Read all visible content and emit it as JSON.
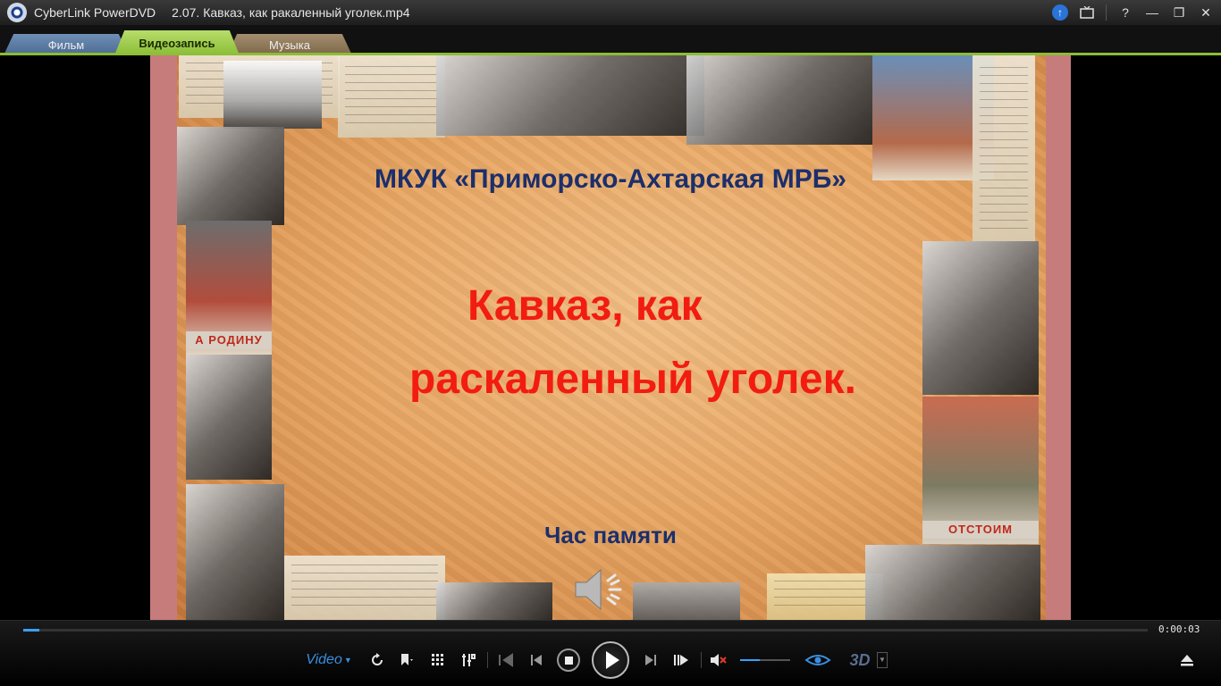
{
  "window": {
    "app_name": "CyberLink PowerDVD",
    "file_name": "2.07. Кавказ, как ракаленный уголек.mp4",
    "help_label": "?",
    "minimize_label": "—",
    "maximize_label": "❐",
    "close_label": "✕"
  },
  "tabs": [
    {
      "label": "Фильм"
    },
    {
      "label": "Видеозапись",
      "active": true
    },
    {
      "label": "Музыка"
    }
  ],
  "slide": {
    "org": "МКУК «Приморско-Ахтарская МРБ»",
    "title_line1": "Кавказ, как",
    "title_line2": "раскаленный уголек.",
    "subtitle": "Час памяти",
    "poster_left": "А РОДИНУ",
    "poster_right": "ОТСТОИМ",
    "colors": {
      "title": "#f21c10",
      "org": "#1c2f6b"
    }
  },
  "controls": {
    "timecode": "0:00:03",
    "progress": 0.014,
    "volume": 0.4,
    "video_menu_label": "Video",
    "threed_label": "3D",
    "icons": [
      "repeat-icon",
      "bookmark-icon",
      "grid-icon",
      "tools-icon",
      "prev-chapter-icon",
      "prev-icon",
      "stop-icon",
      "play-icon",
      "next-icon",
      "next-chapter-icon",
      "mute-icon",
      "eye-icon",
      "3d-icon",
      "eject-icon"
    ]
  }
}
